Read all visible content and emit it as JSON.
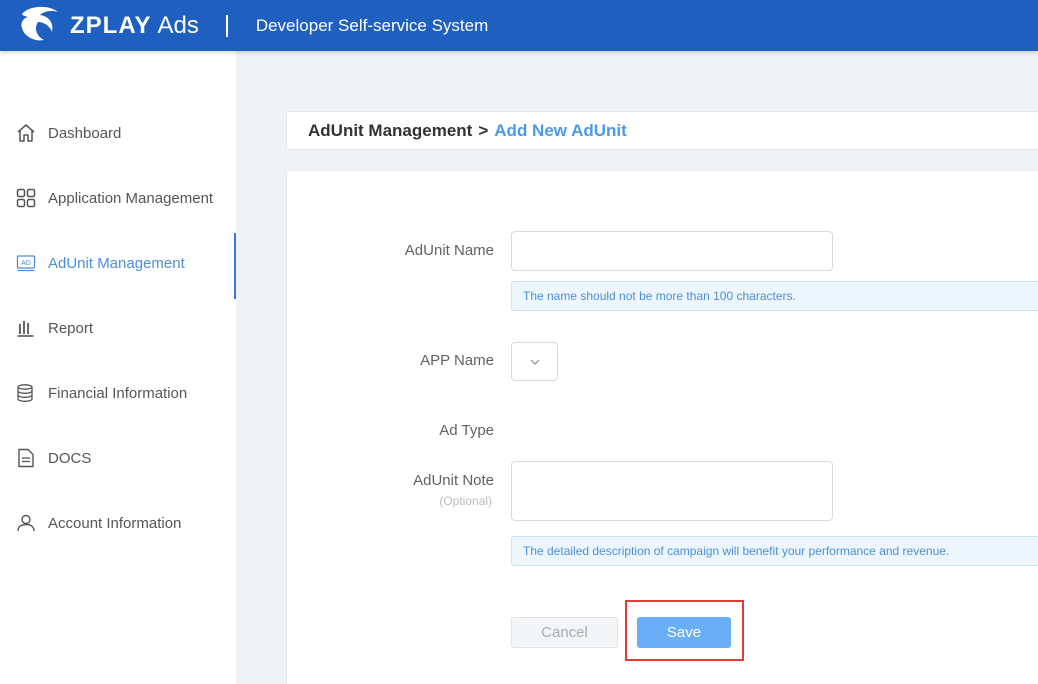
{
  "header": {
    "brand": "ZPLAY",
    "brand_suffix": "Ads",
    "system_title": "Developer Self-service System"
  },
  "sidebar": {
    "items": [
      {
        "label": "Dashboard",
        "icon": "home-icon",
        "active": false
      },
      {
        "label": "Application Management",
        "icon": "grid-icon",
        "active": false
      },
      {
        "label": "AdUnit Management",
        "icon": "ad-icon",
        "active": true
      },
      {
        "label": "Report",
        "icon": "bar-chart-icon",
        "active": false
      },
      {
        "label": "Financial Information",
        "icon": "coins-stack-icon",
        "active": false
      },
      {
        "label": "DOCS",
        "icon": "document-icon",
        "active": false
      },
      {
        "label": "Account Information",
        "icon": "user-icon",
        "active": false
      }
    ]
  },
  "breadcrumb": {
    "parent": "AdUnit Management",
    "separator": ">",
    "current": "Add New AdUnit"
  },
  "form": {
    "adunit_name": {
      "label": "AdUnit Name",
      "value": "",
      "hint": "The name should not be more than 100 characters."
    },
    "app_name": {
      "label": "APP Name",
      "value": ""
    },
    "ad_type": {
      "label": "Ad Type"
    },
    "adunit_note": {
      "label": "AdUnit Note",
      "sublabel": "(Optional)",
      "value": "",
      "hint": "The detailed description of campaign will benefit your performance and revenue."
    },
    "cancel_label": "Cancel",
    "save_label": "Save"
  },
  "colors": {
    "header_bg": "#1f5fbf",
    "accent": "#4a9ae8",
    "save_button": "#6aaef5",
    "highlight_box": "#e53935"
  }
}
